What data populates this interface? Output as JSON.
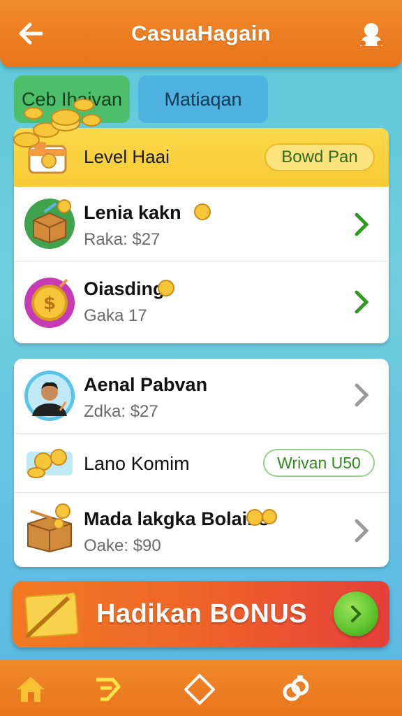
{
  "header": {
    "title": "CasuaHagain",
    "back_icon": "arrow-left-icon",
    "profile_icon": "user-profile-icon"
  },
  "tabs": [
    {
      "label": "Ceb Ihaivan",
      "color": "#4dbf6a"
    },
    {
      "label": "Matiaqan",
      "color": "#4fb3e0"
    }
  ],
  "level": {
    "label": "Level Haai",
    "button_label": "Bowd Pan"
  },
  "card1_items": [
    {
      "title": "Lenia kakn",
      "subtitle": "Raka: $27",
      "icon": "treasure-box-icon"
    },
    {
      "title": "Oiasding",
      "subtitle": "Gaka 17",
      "icon": "coin-badge-icon"
    }
  ],
  "card2_items": [
    {
      "title": "Aenal Pabvan",
      "subtitle": "Zdka: $27",
      "icon": "avatar-icon"
    },
    {
      "title": "Lano Komim",
      "button_label": "Wrivan U50",
      "icon": "coins-icon"
    },
    {
      "title": "Mada lakgka Bolains",
      "subtitle": "Oake: $90",
      "icon": "treasure-chest-icon"
    }
  ],
  "bonus": {
    "label": "Hadikan BONUS"
  },
  "bottom_nav": [
    {
      "icon": "home-icon"
    },
    {
      "icon": "quests-icon"
    },
    {
      "icon": "diamond-icon"
    },
    {
      "icon": "link-icon"
    }
  ],
  "colors": {
    "header": "#e8741c",
    "accent_green": "#2f9a1f",
    "level_bar": "#f7cc35",
    "bonus_start": "#f07a22",
    "bonus_end": "#e53f3a"
  }
}
